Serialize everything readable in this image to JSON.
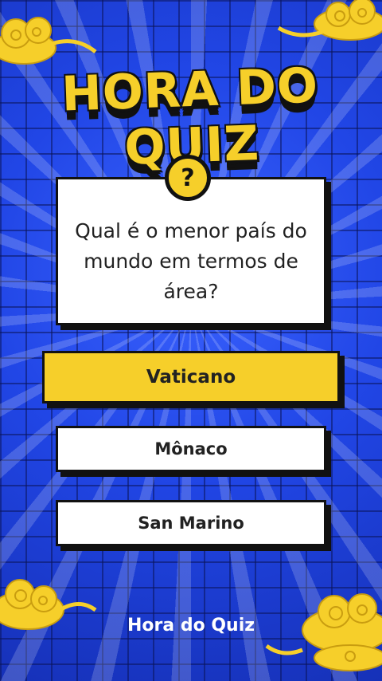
{
  "title": "HORA DO QUIZ",
  "question": {
    "badge": "?",
    "text": "Qual é o menor país do mundo em termos de área?"
  },
  "options": [
    {
      "label": "Vaticano",
      "selected": true
    },
    {
      "label": "Mônaco",
      "selected": false
    },
    {
      "label": "San Marino",
      "selected": false
    }
  ],
  "footer": "Hora do Quiz",
  "colors": {
    "accent": "#f6cf2a",
    "background": "#2146e6",
    "outline": "#111111"
  }
}
